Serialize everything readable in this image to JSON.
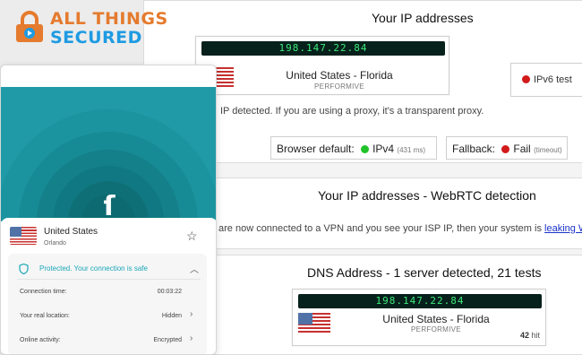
{
  "site": {
    "logo_line1": "ALL THINGS",
    "logo_line2": "SECURED"
  },
  "ip_section": {
    "title": "Your IP addresses",
    "ip": "198.147.22.84",
    "location": "United States - Florida",
    "isp": "PERFORMIVE",
    "ipv6_label": "IPv6 test",
    "proxy_note": "IP detected. If you are using a proxy, it's a transparent proxy.",
    "browser_default_label": "Browser default:",
    "browser_default_value": "IPv4",
    "browser_default_time": "(431 ms)",
    "fallback_label": "Fallback:",
    "fallback_value": "Fail",
    "fallback_time": "(timeout)"
  },
  "webrtc_section": {
    "title": "Your IP addresses - WebRTC detection",
    "note": "are now connected to a VPN and you see your ISP IP, then your system is",
    "link": "leaking W"
  },
  "dns_section": {
    "title": "DNS Address - 1 server detected, 21 tests",
    "ip": "198.147.22.84",
    "location": "United States - Florida",
    "isp": "PERFORMIVE",
    "hits": "42",
    "hits_label": "hit"
  },
  "vpn_app": {
    "country": "United States",
    "city": "Orlando",
    "status": "Protected. Your connection is safe",
    "rows": [
      {
        "label": "Connection time:",
        "value": "00:03:22"
      },
      {
        "label": "Your real location:",
        "value": "Hidden"
      },
      {
        "label": "Online activity:",
        "value": "Encrypted"
      }
    ]
  },
  "colors": {
    "logo_orange": "#e57b2e",
    "logo_blue": "#1e9be2",
    "vpn_teal": "#1f9aa6",
    "ip_green": "#3de97a",
    "status_ok": "#22c22a",
    "status_fail": "#d11a1a",
    "link": "#1a33c8"
  },
  "icons": [
    "lock-logo-icon",
    "us-flag-icon",
    "red-dot-icon",
    "green-dot-icon",
    "surfshark-logo-icon",
    "star-icon",
    "shield-icon",
    "chevron-up-icon",
    "chevron-right-icon"
  ]
}
